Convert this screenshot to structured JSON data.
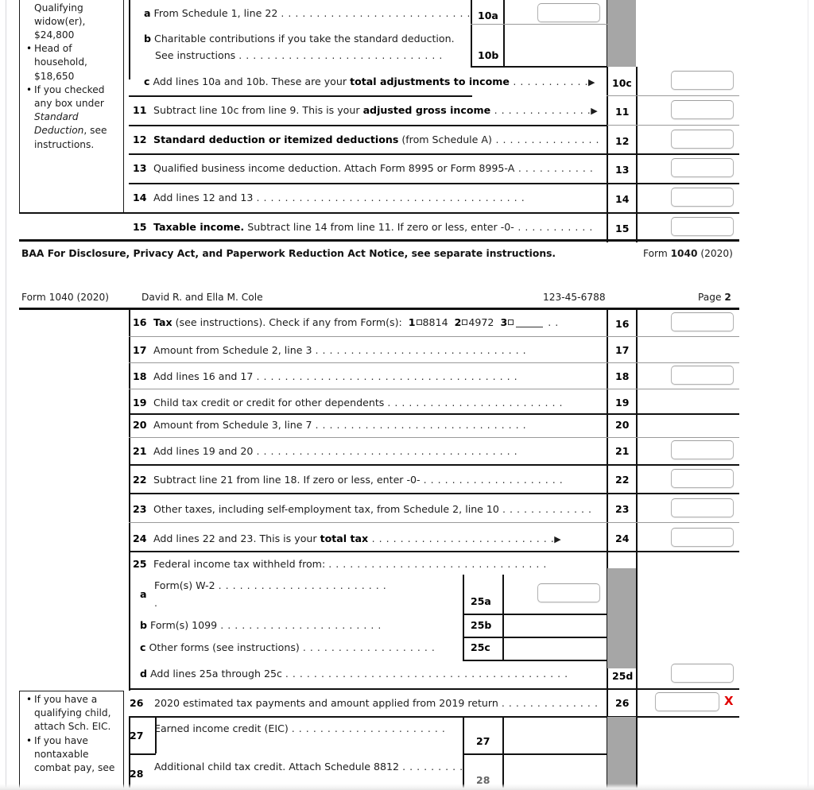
{
  "document": {
    "form_name": "Form 1040",
    "form_year": "(2020)",
    "taxpayer_names": "David R. and Ella M. Cole",
    "ssn": "123-45-6788",
    "page_label": "Page",
    "page_number": "2"
  },
  "page1": {
    "sidenote": {
      "lines": [
        {
          "text": "Qualifying",
          "bullet": false,
          "indent": true
        },
        {
          "text": "widow(er),",
          "bullet": false,
          "indent": true
        },
        {
          "text": "$24,800",
          "bullet": false,
          "indent": true
        },
        {
          "text": "Head of",
          "bullet": true,
          "indent": false
        },
        {
          "text": "household,",
          "bullet": false,
          "indent": true
        },
        {
          "text": "$18,650",
          "bullet": false,
          "indent": true
        },
        {
          "text": "If you checked",
          "bullet": true,
          "indent": false
        },
        {
          "text": "any box under",
          "bullet": false,
          "indent": true
        },
        {
          "text": "Standard",
          "bullet": false,
          "indent": true,
          "italic": true
        },
        {
          "text": "Deduction, see",
          "bullet": false,
          "indent": true,
          "italic_prefix": "Deduction"
        },
        {
          "text": "instructions.",
          "bullet": false,
          "indent": true
        }
      ]
    },
    "rows": [
      {
        "num": "a",
        "num_bold": true,
        "text_plain": "From Schedule 1, line 22 ",
        "dots": ". . . . . . . . . . . . . . . . . . . . . . . . . . .",
        "box_label": "10a",
        "has_field": true,
        "field_col": "sub"
      },
      {
        "num": "b",
        "num_bold": true,
        "text_plain": "Charitable contributions if you take the standard deduction.",
        "text_line2": "See instructions ",
        "dots2": ". . . . . . . . . . . . . . . . . . . . . . . . . . . . .",
        "box_label": "10b",
        "has_field": false,
        "field_col": "sub"
      },
      {
        "num": "c",
        "num_bold": true,
        "pre": "Add lines 10a and 10b. These are your ",
        "bold": "total adjustments to income",
        "dots": " . . . . . . . . . . .",
        "arrow": true,
        "box_label": "10c",
        "has_field": true
      },
      {
        "num": "11",
        "pre": "Subtract line 10c from line 9. This is your ",
        "bold": "adjusted gross income",
        "dots": " . . . . . . . . . . . . . .",
        "arrow": true,
        "box_label": "11",
        "has_field": true
      },
      {
        "num": "12",
        "bold_first": "Standard deduction or itemized deductions",
        "post": " (from Schedule A)",
        "dots": " . . . . . . . . . . . . . . .",
        "box_label": "12",
        "has_field": true
      },
      {
        "num": "13",
        "text_plain": "Qualified business income deduction. Attach Form 8995 or Form 8995-A",
        "dots": " . . . . . . . . . . .",
        "box_label": "13",
        "has_field": true
      },
      {
        "num": "14",
        "text_plain": "Add lines 12 and 13 ",
        "dots": ". . . . . . . . . . . . . . . . . . . . . . . . . . . . . . . . . . . . . .",
        "box_label": "14",
        "has_field": true
      },
      {
        "num": "15",
        "bold_first": "Taxable income.",
        "post": " Subtract line 14 from line 11. If zero or less, enter -0-",
        "dots": " . . . . . . . . . . .",
        "box_label": "15",
        "has_field": true
      }
    ],
    "footer": {
      "notice": "BAA For Disclosure, Privacy Act, and Paperwork Reduction Act Notice, see separate instructions.",
      "form_prefix": "Form ",
      "form_bold": "1040",
      "form_suffix": " (2020)"
    }
  },
  "page2": {
    "header": {
      "form": "Form 1040 (2020)",
      "names": "David R. and Ella M. Cole",
      "ssn": "123-45-6788",
      "page_prefix": "Page ",
      "page_num": "2"
    },
    "line16": {
      "num": "16",
      "bold_first": "Tax",
      "mid": " (see instructions). Check if any from Form(s):",
      "opt1_num": "1",
      "opt1_label": "8814",
      "opt2_num": "2",
      "opt2_label": "4972",
      "opt3_num": "3",
      "opt3_label": "",
      "tail_dots": ". .",
      "box_label": "16",
      "has_field": true
    },
    "rows": [
      {
        "num": "17",
        "text_plain": "Amount from Schedule 2, line 3 ",
        "dots": ". . . . . . . . . . . . . . . . . . . . . . . . . . . . . .",
        "box_label": "17",
        "has_field": false
      },
      {
        "num": "18",
        "text_plain": "Add lines 16 and 17 ",
        "dots": ". . . . . . . . . . . . . . . . . . . . . . . . . . . . . . . . . . . . .",
        "box_label": "18",
        "has_field": true
      },
      {
        "num": "19",
        "text_plain": "Child tax credit or credit for other dependents ",
        "dots": ". . . . . . . . . . . . . . . . . . . . . . . . .",
        "box_label": "19",
        "has_field": false
      },
      {
        "num": "20",
        "text_plain": "Amount from Schedule 3, line 7 ",
        "dots": ". . . . . . . . . . . . . . . . . . . . . . . . . . . . . .",
        "box_label": "20",
        "has_field": false
      },
      {
        "num": "21",
        "text_plain": "Add lines 19 and 20 ",
        "dots": ". . . . . . . . . . . . . . . . . . . . . . . . . . . . . . . . . . . . .",
        "box_label": "21",
        "has_field": true
      },
      {
        "num": "22",
        "text_plain": "Subtract line 21 from line 18. If zero or less, enter -0- ",
        "dots": ". . . . . . . . . . . . . . . . . . . .",
        "box_label": "22",
        "has_field": true
      },
      {
        "num": "23",
        "text_plain": "Other taxes, including self-employment tax, from Schedule 2, line 10 ",
        "dots": ". . . . . . . . . . . . .",
        "box_label": "23",
        "has_field": true
      },
      {
        "num": "24",
        "pre": "Add lines 22 and 23. This is your ",
        "bold": "total tax",
        "dots": " . . . . . . . . . . . . . . . . . . . . . . . . . .",
        "arrow": true,
        "box_label": "24",
        "has_field": true
      },
      {
        "num": "25",
        "text_plain": "Federal income tax withheld from: ",
        "dots": ". . . . . . . . . . . . . . . . . . . . . . . . . . . . . . .",
        "box_label": "",
        "has_field": false
      }
    ],
    "sub25": [
      {
        "num": "a",
        "text_plain": "Form(s) W-2 ",
        "dots": ". . . . . . . . . . . . . . . . . . . . . . . .",
        "trailing_dot": ".",
        "box_label": "25a",
        "has_field": true
      },
      {
        "num": "b",
        "text_plain": "Form(s) 1099 ",
        "dots": ". . . . . . . . . . . . . . . . . . . . . . .",
        "box_label": "25b",
        "has_field": false
      },
      {
        "num": "c",
        "text_plain": "Other forms (see instructions) ",
        "dots": ". . . . . . . . . . . . . . . . . . .",
        "box_label": "25c",
        "has_field": false
      }
    ],
    "row25d": {
      "num": "d",
      "text_plain": "Add lines 25a through 25c ",
      "dots": ". . . . . . . . . . . . . . . . . . . . . . . . . . . . . . . . . . . . . . . .",
      "box_label": "25d",
      "has_field": true
    },
    "sidenote": {
      "lines": [
        {
          "text": "If you have a",
          "bullet": true
        },
        {
          "text": "qualifying child,",
          "bullet": false
        },
        {
          "text": "attach Sch. EIC.",
          "bullet": false
        },
        {
          "text": "If you have",
          "bullet": true
        },
        {
          "text": "nontaxable",
          "bullet": false
        },
        {
          "text": "combat pay, see",
          "bullet": false
        }
      ]
    },
    "row26": {
      "num": "26",
      "text_plain": "2020 estimated tax payments and amount applied from 2019 return ",
      "dots": ". . . . . . . . . . . . . .",
      "box_label": "26",
      "has_field": true,
      "marker": "X",
      "marker_color": "#e00000"
    },
    "row27": {
      "num": "27",
      "text_plain": "Earned income credit (EIC) ",
      "dots": ". . . . . . . . . . . . . . . . . . . . . .",
      "trailing_dot": ".",
      "box_label": "27",
      "has_field": false
    },
    "row28": {
      "num": "28",
      "text_plain": "Additional child tax credit. Attach Schedule 8812 ",
      "dots": ". . . . . . . . .",
      "box_label": "28",
      "has_field": false
    }
  }
}
